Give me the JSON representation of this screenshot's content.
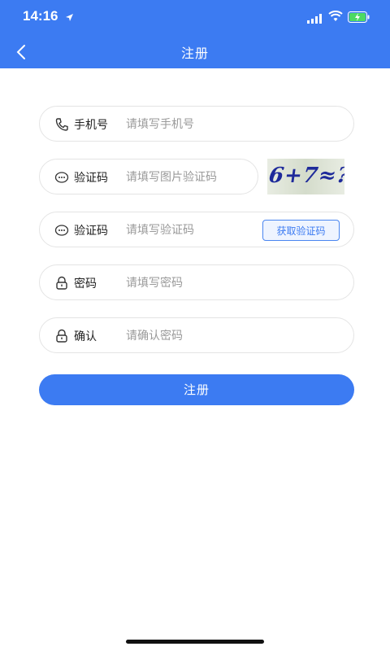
{
  "status_bar": {
    "time": "14:16"
  },
  "nav": {
    "title": "注册"
  },
  "form": {
    "phone": {
      "label": "手机号",
      "placeholder": "请填写手机号"
    },
    "image_code": {
      "label": "验证码",
      "placeholder": "请填写图片验证码",
      "captcha_text": "6+7≈?"
    },
    "sms_code": {
      "label": "验证码",
      "placeholder": "请填写验证码",
      "button_label": "获取验证码"
    },
    "password": {
      "label": "密码",
      "placeholder": "请填写密码"
    },
    "confirm": {
      "label": "确认",
      "placeholder": "请确认密码"
    },
    "submit_label": "注册"
  },
  "colors": {
    "primary": "#3c7bf2",
    "border": "#e4e4e4",
    "placeholder": "#9a9a9a"
  }
}
